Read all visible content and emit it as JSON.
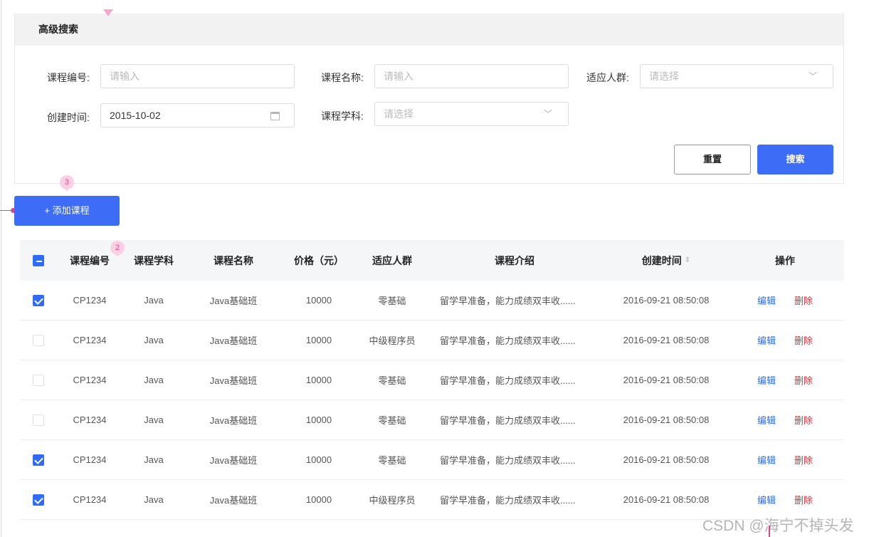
{
  "search": {
    "title": "高级搜索",
    "fields": {
      "course_no": {
        "label": "课程编号:",
        "placeholder": "请输入",
        "value": ""
      },
      "course_name": {
        "label": "课程名称:",
        "placeholder": "请输入",
        "value": ""
      },
      "audience": {
        "label": "适应人群:",
        "placeholder": "请选择",
        "value": ""
      },
      "created": {
        "label": "创建时间:",
        "value": "2015-10-02"
      },
      "subject": {
        "label": "课程学科:",
        "placeholder": "请选择",
        "value": ""
      }
    },
    "reset_label": "重置",
    "search_label": "搜索"
  },
  "toolbar": {
    "add_label": "+ 添加课程"
  },
  "markers": {
    "m2": "2",
    "m3": "3"
  },
  "table": {
    "headers": {
      "course_no": "课程编号",
      "subject": "课程学科",
      "name": "课程名称",
      "price": "价格（元）",
      "audience": "适应人群",
      "intro": "课程介绍",
      "created": "创建时间",
      "actions": "操作"
    },
    "header_checkbox": "indeterminate",
    "rows": [
      {
        "checked": true,
        "course_no": "CP1234",
        "subject": "Java",
        "name": "Java基础班",
        "price": "10000",
        "audience": "零基础",
        "intro": "留学早准备，能力成绩双丰收......",
        "created": "2016-09-21  08:50:08",
        "edit": "编辑",
        "delete": "删除"
      },
      {
        "checked": false,
        "course_no": "CP1234",
        "subject": "Java",
        "name": "Java基础班",
        "price": "10000",
        "audience": "中级程序员",
        "intro": "留学早准备，能力成绩双丰收......",
        "created": "2016-09-21  08:50:08",
        "edit": "编辑",
        "delete": "删除"
      },
      {
        "checked": false,
        "course_no": "CP1234",
        "subject": "Java",
        "name": "Java基础班",
        "price": "10000",
        "audience": "零基础",
        "intro": "留学早准备，能力成绩双丰收......",
        "created": "2016-09-21  08:50:08",
        "edit": "编辑",
        "delete": "删除"
      },
      {
        "checked": false,
        "course_no": "CP1234",
        "subject": "Java",
        "name": "Java基础班",
        "price": "10000",
        "audience": "零基础",
        "intro": "留学早准备，能力成绩双丰收......",
        "created": "2016-09-21  08:50:08",
        "edit": "编辑",
        "delete": "删除"
      },
      {
        "checked": true,
        "course_no": "CP1234",
        "subject": "Java",
        "name": "Java基础班",
        "price": "10000",
        "audience": "零基础",
        "intro": "留学早准备，能力成绩双丰收......",
        "created": "2016-09-21  08:50:08",
        "edit": "编辑",
        "delete": "删除"
      },
      {
        "checked": true,
        "course_no": "CP1234",
        "subject": "Java",
        "name": "Java基础班",
        "price": "10000",
        "audience": "中级程序员",
        "intro": "留学早准备，能力成绩双丰收......",
        "created": "2016-09-21  08:50:08",
        "edit": "编辑",
        "delete": "删除"
      }
    ]
  },
  "watermark": "CSDN @海宁不掉头发",
  "colors": {
    "primary": "#3d6cf7",
    "danger": "#e02f3a",
    "annotation": "#e0458a"
  }
}
